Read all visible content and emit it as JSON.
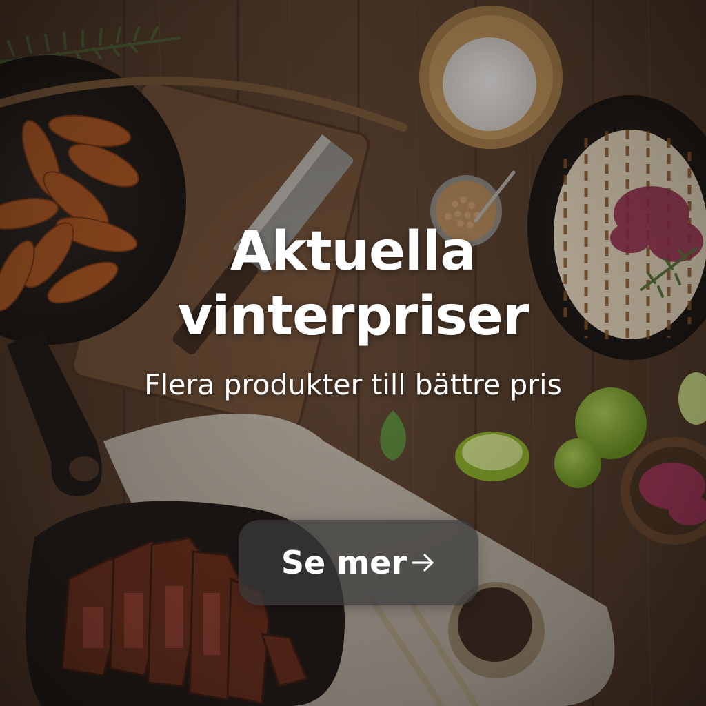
{
  "hero": {
    "headline_line1": "Aktuella",
    "headline_line2": "vinterpriser",
    "subheadline": "Flera produkter till bättre pris",
    "cta_label": "Se mer",
    "cta_icon": "arrow-right-icon",
    "background_image": "food-table-photo"
  },
  "colors": {
    "text": "#ffffff",
    "button_bg": "#3c3c3c",
    "wood": "#5a4230"
  }
}
